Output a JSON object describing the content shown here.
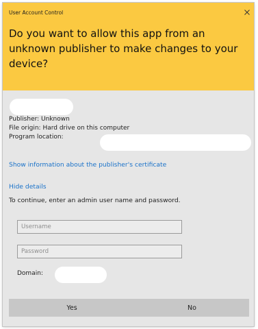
{
  "window": {
    "title": "User Account Control",
    "close_icon": "close-icon"
  },
  "header": {
    "question": "Do you want to allow this app from an unknown publisher to make changes to your device?",
    "background": "#fbc941"
  },
  "details": {
    "publisher": "Publisher: Unknown",
    "file_origin": "File origin: Hard drive on this computer",
    "program_location": "Program location:"
  },
  "links": {
    "certificate": "Show information about the publisher's certificate",
    "hide_details": "Hide details",
    "color": "#1a72c9"
  },
  "form": {
    "instructions": "To continue, enter an admin user name and password.",
    "username_placeholder": "Username",
    "password_placeholder": "Password",
    "domain_label": "Domain:"
  },
  "buttons": {
    "yes": "Yes",
    "no": "No"
  }
}
